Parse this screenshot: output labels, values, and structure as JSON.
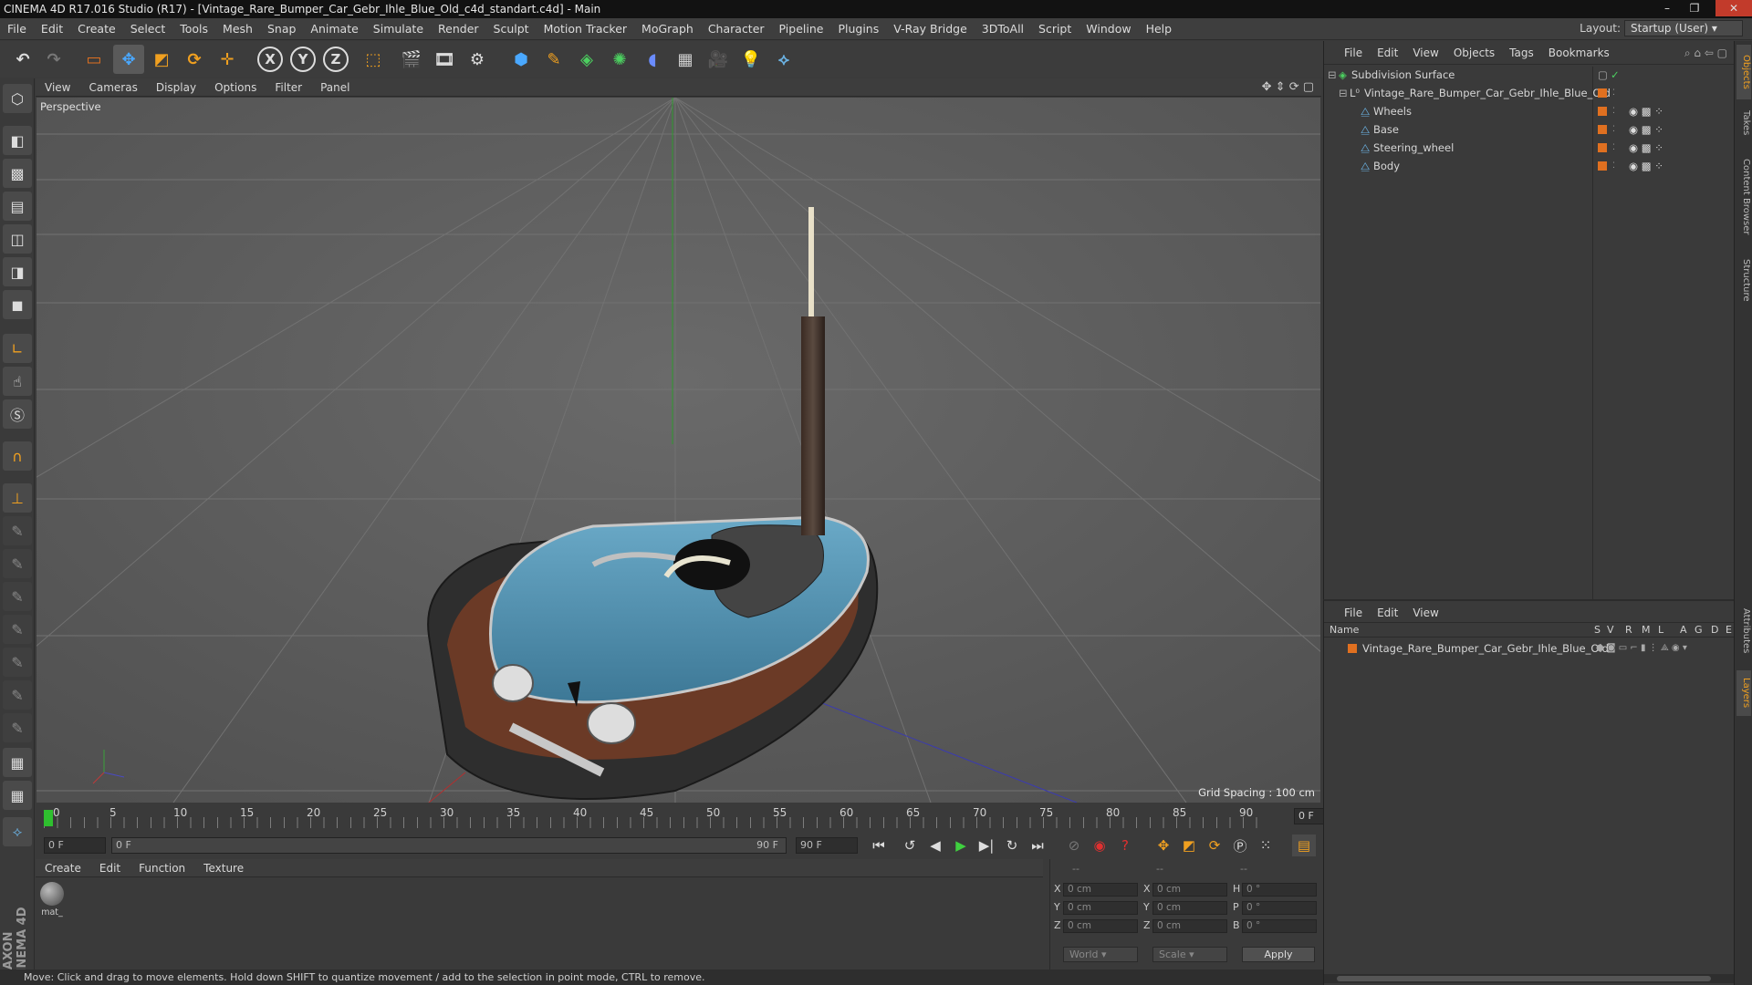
{
  "titlebar": {
    "title": "CINEMA 4D R17.016 Studio (R17) - [Vintage_Rare_Bumper_Car_Gebr_Ihle_Blue_Old_c4d_standart.c4d] - Main"
  },
  "menubar": {
    "items": [
      "File",
      "Edit",
      "Create",
      "Select",
      "Tools",
      "Mesh",
      "Snap",
      "Animate",
      "Simulate",
      "Render",
      "Sculpt",
      "Motion Tracker",
      "MoGraph",
      "Character",
      "Pipeline",
      "Plugins",
      "V-Ray Bridge",
      "3DToAll",
      "Script",
      "Window",
      "Help"
    ]
  },
  "layout": {
    "label": "Layout:",
    "value": "Startup (User)"
  },
  "toolbar": {
    "axis_x": "X",
    "axis_y": "Y",
    "axis_z": "Z"
  },
  "viewport": {
    "menu": [
      "View",
      "Cameras",
      "Display",
      "Options",
      "Filter",
      "Panel"
    ],
    "label": "Perspective",
    "grid_spacing": "Grid Spacing : 100 cm"
  },
  "timeline": {
    "ticks": [
      "0",
      "5",
      "10",
      "15",
      "20",
      "25",
      "30",
      "35",
      "40",
      "45",
      "50",
      "55",
      "60",
      "65",
      "70",
      "75",
      "80",
      "85",
      "90"
    ],
    "current_frame": "0 F",
    "start_field": "0 F",
    "range_start": "0 F",
    "range_end": "90 F",
    "end_field": "90 F"
  },
  "material_manager": {
    "menu": [
      "Create",
      "Edit",
      "Function",
      "Texture"
    ],
    "materials": [
      {
        "name": "mat_"
      }
    ]
  },
  "coordinates": {
    "headers": [
      "--",
      "--",
      "--"
    ],
    "rows": [
      {
        "a": "X",
        "av": "0 cm",
        "b": "X",
        "bv": "0 cm",
        "c": "H",
        "cv": "0 °"
      },
      {
        "a": "Y",
        "av": "0 cm",
        "b": "Y",
        "bv": "0 cm",
        "c": "P",
        "cv": "0 °"
      },
      {
        "a": "Z",
        "av": "0 cm",
        "b": "Z",
        "bv": "0 cm",
        "c": "B",
        "cv": "0 °"
      }
    ],
    "mode1": "World",
    "mode2": "Scale",
    "apply": "Apply"
  },
  "statusbar": {
    "text": "Move: Click and drag to move elements. Hold down SHIFT to quantize movement / add to the selection in point mode, CTRL to remove."
  },
  "object_manager": {
    "menu": [
      "File",
      "Edit",
      "View",
      "Objects",
      "Tags",
      "Bookmarks"
    ],
    "objects": [
      {
        "name": "Subdivision Surface",
        "level": 0
      },
      {
        "name": "Vintage_Rare_Bumper_Car_Gebr_Ihle_Blue_Old",
        "level": 1
      },
      {
        "name": "Wheels",
        "level": 2
      },
      {
        "name": "Base",
        "level": 2
      },
      {
        "name": "Steering_wheel",
        "level": 2
      },
      {
        "name": "Body",
        "level": 2
      }
    ]
  },
  "layer_manager": {
    "menu": [
      "File",
      "Edit",
      "View"
    ],
    "name_header": "Name",
    "flags": [
      "S",
      "V",
      "R",
      "M",
      "L",
      "A",
      "G",
      "D",
      "E"
    ],
    "layers": [
      {
        "name": "Vintage_Rare_Bumper_Car_Gebr_Ihle_Blue_Old",
        "color": "#e07020"
      }
    ]
  },
  "right_tabs": [
    "Objects",
    "Takes",
    "Content Browser",
    "Structure",
    "Attributes",
    "Layers"
  ],
  "colors": {
    "accent_orange": "#e07020",
    "viewport_bg": "#5c5c5c",
    "car_blue": "#4d8fb0"
  }
}
